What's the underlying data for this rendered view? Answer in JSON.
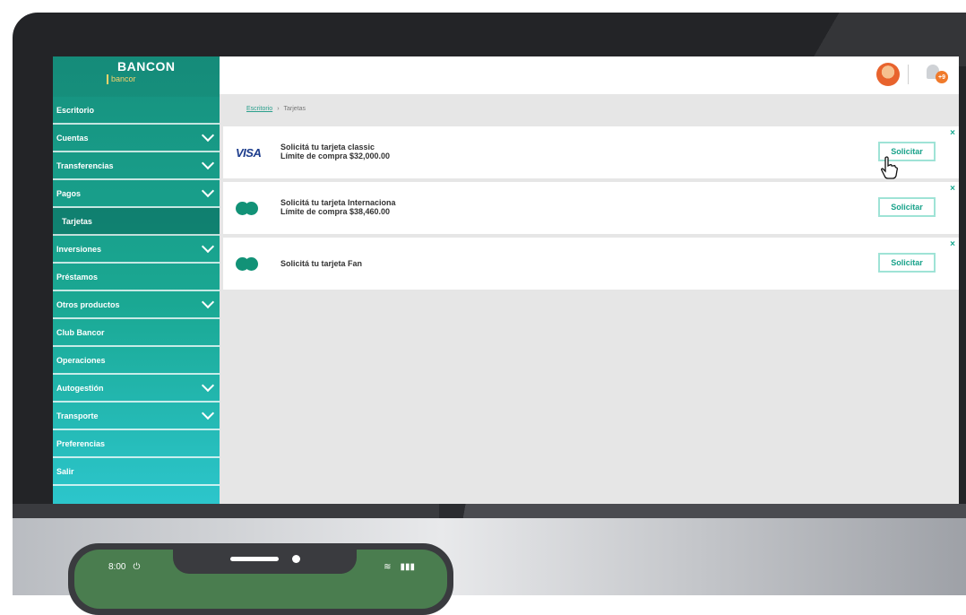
{
  "brand": {
    "name": "BANCON",
    "sub": "bancor"
  },
  "sidebar": {
    "items": [
      {
        "label": "Escritorio",
        "chevron": false
      },
      {
        "label": "Cuentas",
        "chevron": true
      },
      {
        "label": "Transferencias",
        "chevron": true
      },
      {
        "label": "Pagos",
        "chevron": true
      },
      {
        "label": "Tarjetas",
        "chevron": false,
        "active": true
      },
      {
        "label": "Inversiones",
        "chevron": true
      },
      {
        "label": "Préstamos",
        "chevron": false
      },
      {
        "label": "Otros productos",
        "chevron": true
      },
      {
        "label": "Club Bancor",
        "chevron": false
      },
      {
        "label": "Operaciones",
        "chevron": false
      },
      {
        "label": "Autogestión",
        "chevron": true
      },
      {
        "label": "Transporte",
        "chevron": true
      },
      {
        "label": "Preferencias",
        "chevron": false
      },
      {
        "label": "Salir",
        "chevron": false
      }
    ]
  },
  "topbar": {
    "notification_badge": "+9"
  },
  "breadcrumb": {
    "home": "Escritorio",
    "separator": "›",
    "current": "Tarjetas"
  },
  "cards": [
    {
      "logo": "VISA",
      "line1": "Solicitá tu tarjeta classic",
      "line2": "Límite de compra $32,000.00",
      "button": "Solicitar",
      "close": "×"
    },
    {
      "logo": "mastercard-icon",
      "line1": "Solicitá tu tarjeta Internaciona",
      "line2": "Límite de compra $38,460.00",
      "button": "Solicitar",
      "close": "×"
    },
    {
      "logo": "mastercard-icon",
      "line1": "Solicitá tu tarjeta Fan",
      "line2": "",
      "button": "Solicitar",
      "close": "×"
    }
  ],
  "phone": {
    "time": "8:00"
  },
  "colors": {
    "accent": "#18a28a",
    "sidebar_top": "#16917e",
    "sidebar_bottom": "#2cc6cc",
    "visa_blue": "#1c3c8c"
  }
}
